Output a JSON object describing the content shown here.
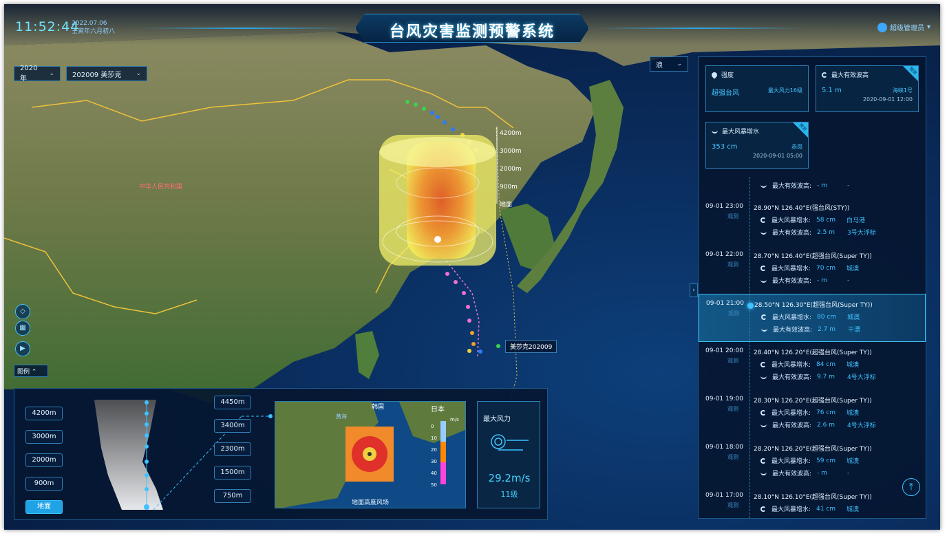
{
  "header": {
    "clock": "11:52:44",
    "date": "2022.07.06",
    "lunar": "壬寅年六月初八",
    "title": "台风灾害监测预警系统",
    "user": "超级管理员"
  },
  "filters": {
    "year": "2020年",
    "typhoon": "202009 美莎克",
    "layer": "浪"
  },
  "map": {
    "country_label": "中华人民共和国",
    "typhoon_label": "美莎克202009",
    "altitude_labels": [
      "4200m",
      "3000m",
      "2000m",
      "900m",
      "地面"
    ]
  },
  "cards": {
    "intensity": {
      "caption": "强度",
      "value": "超强台风",
      "sub": "最大风力16级"
    },
    "wave": {
      "caption": "最大有效波高",
      "value": "5.1 m",
      "sub": "海峡1号",
      "time": "2020-09-01 12:00",
      "badge": "预测"
    },
    "surge": {
      "caption": "最大风暴增水",
      "value": "353 cm",
      "sub": "赤岗",
      "time": "2020-09-01 05:00",
      "badge": "预测"
    }
  },
  "timeline": {
    "top_row": {
      "label": "最大有效波高:",
      "value": "- m",
      "loc": "-"
    },
    "items": [
      {
        "time": "09-01 23:00",
        "obs": "观测",
        "head": "28.90°N 126.40°E(强台风(STY))",
        "r1": {
          "label": "最大风暴增水:",
          "value": "58 cm",
          "loc": "白马港"
        },
        "r2": {
          "label": "最大有效波高:",
          "value": "2.5 m",
          "loc": "3号大浮标"
        }
      },
      {
        "time": "09-01 22:00",
        "obs": "观测",
        "head": "28.70°N 126.40°E(超强台风(Super TY))",
        "r1": {
          "label": "最大风暴增水:",
          "value": "70 cm",
          "loc": "城澳"
        },
        "r2": {
          "label": "最大有效波高:",
          "value": "- m",
          "loc": "-"
        }
      },
      {
        "time": "09-01 21:00",
        "obs": "观测",
        "head": "28.50°N 126.30°E(超强台风(Super TY))",
        "r1": {
          "label": "最大风暴增水:",
          "value": "80 cm",
          "loc": "城澳"
        },
        "r2": {
          "label": "最大有效波高:",
          "value": "2.7 m",
          "loc": "干漂"
        }
      },
      {
        "time": "09-01 20:00",
        "obs": "观测",
        "head": "28.40°N 126.20°E(超强台风(Super TY))",
        "r1": {
          "label": "最大风暴增水:",
          "value": "84 cm",
          "loc": "城澳"
        },
        "r2": {
          "label": "最大有效波高:",
          "value": "9.7 m",
          "loc": "4号大浮标"
        }
      },
      {
        "time": "09-01 19:00",
        "obs": "观测",
        "head": "28.30°N 126.20°E(超强台风(Super TY))",
        "r1": {
          "label": "最大风暴增水:",
          "value": "76 cm",
          "loc": "城澳"
        },
        "r2": {
          "label": "最大有效波高:",
          "value": "2.6 m",
          "loc": "4号大浮标"
        }
      },
      {
        "time": "09-01 18:00",
        "obs": "观测",
        "head": "28.20°N 126.20°E(超强台风(Super TY))",
        "r1": {
          "label": "最大风暴增水:",
          "value": "59 cm",
          "loc": "城澳"
        },
        "r2": {
          "label": "最大有效波高:",
          "value": "- m",
          "loc": "-"
        }
      },
      {
        "time": "09-01 17:00",
        "obs": "观测",
        "head": "28.10°N 126.10°E(超强台风(Super TY))",
        "r1": {
          "label": "最大风暴增水:",
          "value": "41 cm",
          "loc": "城澳"
        },
        "r2": {
          "label": "",
          "value": "",
          "loc": ""
        }
      }
    ]
  },
  "tools": {
    "legend": "图例"
  },
  "bottom": {
    "left_altitudes": [
      "4200m",
      "3000m",
      "2000m",
      "900m",
      "地面"
    ],
    "right_altitudes": [
      "4450m",
      "3400m",
      "2300m",
      "1500m",
      "750m"
    ],
    "mini_map": {
      "caption": "地面高度风场",
      "label_korea": "韩国",
      "label_japan": "日本",
      "label_yellow_sea": "黄海",
      "scale_unit": "m/s",
      "scale_ticks": [
        "0",
        "10",
        "20",
        "30",
        "40",
        "50"
      ]
    },
    "wind": {
      "title": "最大风力",
      "value": "29.2m/s",
      "level": "11级"
    }
  },
  "colors": {
    "accent": "#3ec2ff",
    "ocean": "#0a2d5e",
    "land": "#7f8a55",
    "border": "#f0c23a"
  }
}
